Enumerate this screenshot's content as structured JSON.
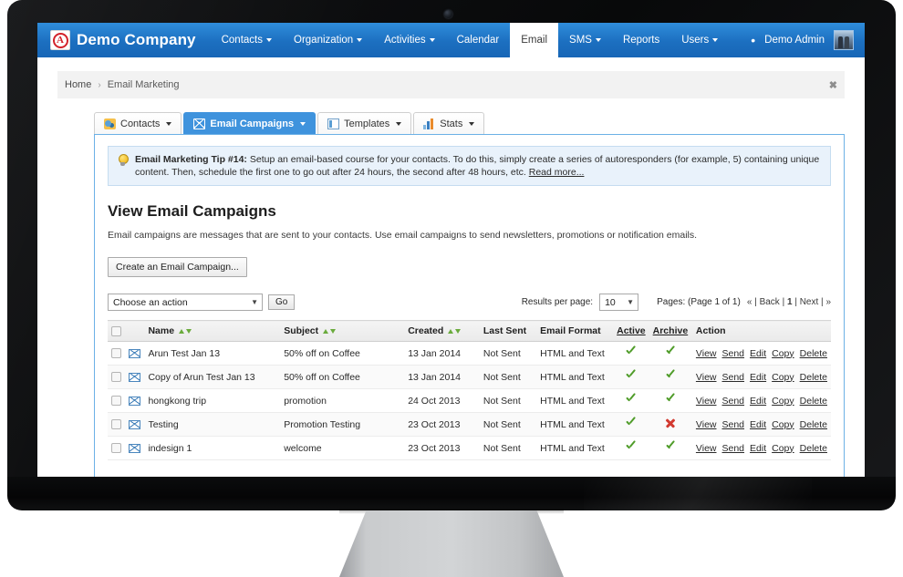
{
  "navbar": {
    "brand": "Demo Company",
    "brand_logo_letter": "A",
    "items": [
      {
        "label": "Contacts",
        "caret": true,
        "active": false
      },
      {
        "label": "Organization",
        "caret": true,
        "active": false
      },
      {
        "label": "Activities",
        "caret": true,
        "active": false
      },
      {
        "label": "Calendar",
        "caret": false,
        "active": false
      },
      {
        "label": "Email",
        "caret": false,
        "active": true
      },
      {
        "label": "SMS",
        "caret": true,
        "active": false
      },
      {
        "label": "Reports",
        "caret": false,
        "active": false
      },
      {
        "label": "Users",
        "caret": true,
        "active": false
      }
    ],
    "drop_icon": "•",
    "admin_label": "Demo Admin"
  },
  "breadcrumb": {
    "home": "Home",
    "separator": "›",
    "current": "Email Marketing",
    "close": "✖"
  },
  "tabs": [
    {
      "label": "Contacts",
      "icon": "contacts-icon",
      "caret": true,
      "active": false
    },
    {
      "label": "Email Campaigns",
      "icon": "envelope-icon",
      "caret": true,
      "active": true
    },
    {
      "label": "Templates",
      "icon": "template-icon",
      "caret": true,
      "active": false
    },
    {
      "label": "Stats",
      "icon": "stats-icon",
      "caret": true,
      "active": false
    }
  ],
  "tip": {
    "title": "Email Marketing Tip #14:",
    "body": " Setup an email-based course for your contacts. To do this, simply create a series of autoresponders (for example, 5) containing unique content. Then, schedule the first one to go out after 24 hours, the second after 48 hours, etc. ",
    "read_more": "Read more..."
  },
  "page": {
    "title": "View Email Campaigns",
    "description": "Email campaigns are messages that are sent to your contacts. Use email campaigns to send newsletters, promotions or notification emails.",
    "create_button": "Create an Email Campaign..."
  },
  "toolbar": {
    "action_select_value": "Choose an action",
    "go_button": "Go",
    "results_per_page_label": "Results per page:",
    "results_per_page_value": "10",
    "pages_label": "Pages: (Page 1 of 1)",
    "pager_first": "«",
    "pager_back": "Back",
    "pager_current": "1",
    "pager_next": "Next",
    "pager_last": "»",
    "pager_sep": "|"
  },
  "table": {
    "headers": {
      "checkbox": "",
      "icon": "",
      "name": "Name",
      "subject": "Subject",
      "created": "Created",
      "last_sent": "Last Sent",
      "email_format": "Email Format",
      "active": "Active",
      "archive": "Archive",
      "action": "Action"
    },
    "action_links": [
      "View",
      "Send",
      "Edit",
      "Copy",
      "Delete"
    ],
    "rows": [
      {
        "name": "Arun Test Jan 13",
        "subject": "50% off on Coffee",
        "created": "13 Jan 2014",
        "last_sent": "Not Sent",
        "email_format": "HTML and Text",
        "active": "check",
        "archive": "check"
      },
      {
        "name": "Copy of Arun Test Jan 13",
        "subject": "50% off on Coffee",
        "created": "13 Jan 2014",
        "last_sent": "Not Sent",
        "email_format": "HTML and Text",
        "active": "check",
        "archive": "check"
      },
      {
        "name": "hongkong trip",
        "subject": "promotion",
        "created": "24 Oct 2013",
        "last_sent": "Not Sent",
        "email_format": "HTML and Text",
        "active": "check",
        "archive": "check"
      },
      {
        "name": "Testing",
        "subject": "Promotion Testing",
        "created": "23 Oct 2013",
        "last_sent": "Not Sent",
        "email_format": "HTML and Text",
        "active": "check",
        "archive": "cross"
      },
      {
        "name": "indesign 1",
        "subject": "welcome",
        "created": "23 Oct 2013",
        "last_sent": "Not Sent",
        "email_format": "HTML and Text",
        "active": "check",
        "archive": "check"
      }
    ]
  },
  "colors": {
    "navbar_blue": "#1c6fc0",
    "tab_active_blue": "#3f93dd",
    "panel_border": "#6cb1e6",
    "tip_bg": "#e9f2fb",
    "check_green": "#4f9c29",
    "cross_red": "#d23a30"
  }
}
